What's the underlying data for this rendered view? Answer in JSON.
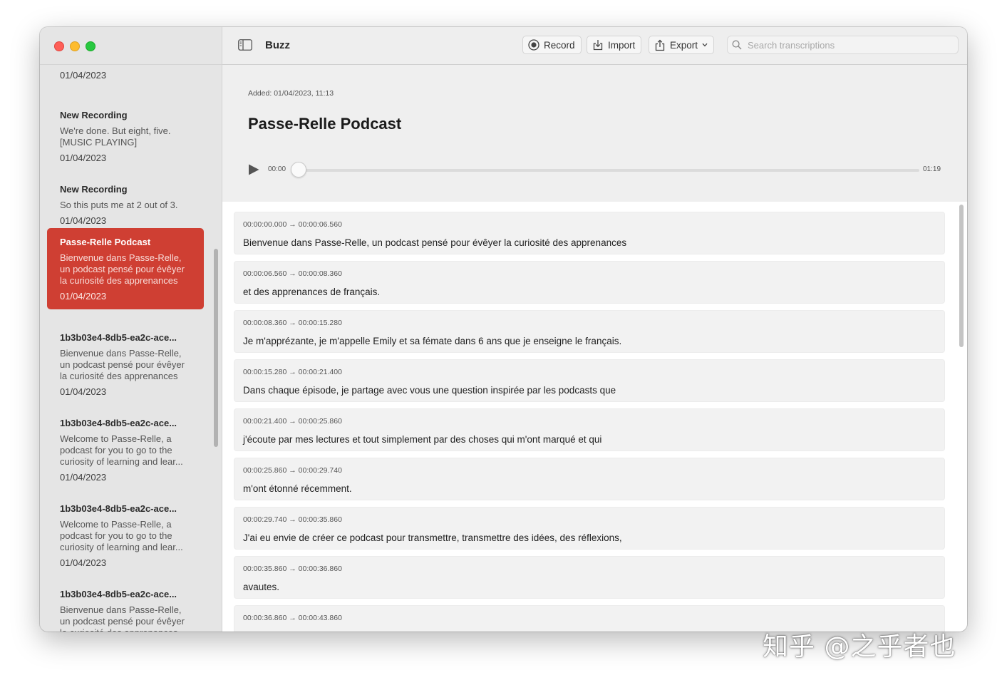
{
  "app": {
    "title": "Buzz"
  },
  "toolbar": {
    "record_label": "Record",
    "import_label": "Import",
    "export_label": "Export",
    "search_placeholder": "Search transcriptions"
  },
  "sidebar": {
    "top_date": "01/04/2023",
    "items": [
      {
        "title": "New Recording",
        "preview": "We're done. But eight, five. [MUSIC PLAYING]",
        "date": "01/04/2023",
        "active": false
      },
      {
        "title": "New Recording",
        "preview": "So this puts me at 2 out of 3.",
        "date": "01/04/2023",
        "active": false
      },
      {
        "title": "Passe-Relle Podcast",
        "preview": "Bienvenue dans Passe-Relle, un podcast pensé pour évêyer la curiosité des apprenances",
        "date": "01/04/2023",
        "active": true
      },
      {
        "title": "1b3b03e4-8db5-ea2c-ace...",
        "preview": "Bienvenue dans Passe-Relle, un podcast pensé pour évêyer la curiosité des apprenances",
        "date": "01/04/2023",
        "active": false
      },
      {
        "title": "1b3b03e4-8db5-ea2c-ace...",
        "preview": "Welcome to Passe-Relle, a podcast for you to go to the curiosity of learning and lear...",
        "date": "01/04/2023",
        "active": false
      },
      {
        "title": "1b3b03e4-8db5-ea2c-ace...",
        "preview": "Welcome to Passe-Relle, a podcast for you to go to the curiosity of learning and lear...",
        "date": "01/04/2023",
        "active": false
      },
      {
        "title": "1b3b03e4-8db5-ea2c-ace...",
        "preview": "Bienvenue dans Passe-Relle, un podcast pensé pour évêyer la curiosité des apprenances",
        "date": "",
        "active": false
      }
    ]
  },
  "detail": {
    "added": "Added: 01/04/2023, 11:13",
    "title": "Passe-Relle Podcast",
    "player": {
      "current": "00:00",
      "total": "01:19",
      "progress": 0
    }
  },
  "segments": [
    {
      "time": "00:00:00.000 → 00:00:06.560",
      "text": "Bienvenue dans Passe-Relle, un podcast pensé pour évêyer la curiosité des apprenances"
    },
    {
      "time": "00:00:06.560 → 00:00:08.360",
      "text": "et des apprenances de français."
    },
    {
      "time": "00:00:08.360 → 00:00:15.280",
      "text": "Je m'apprézante, je m'appelle Emily et sa fémate dans 6 ans que je enseigne le français."
    },
    {
      "time": "00:00:15.280 → 00:00:21.400",
      "text": "Dans chaque épisode, je partage avec vous une question inspirée par les podcasts que"
    },
    {
      "time": "00:00:21.400 → 00:00:25.860",
      "text": "j'écoute par mes lectures et tout simplement par des choses qui m'ont marqué et qui"
    },
    {
      "time": "00:00:25.860 → 00:00:29.740",
      "text": "m'ont étonné récemment."
    },
    {
      "time": "00:00:29.740 → 00:00:35.860",
      "text": "J'ai eu envie de créer ce podcast pour transmettre, transmettre des idées, des réflexions,"
    },
    {
      "time": "00:00:35.860 → 00:00:36.860",
      "text": "avautes."
    },
    {
      "time": "00:00:36.860 → 00:00:43.860",
      "text": ""
    }
  ],
  "watermark": "知乎 @之乎者也"
}
